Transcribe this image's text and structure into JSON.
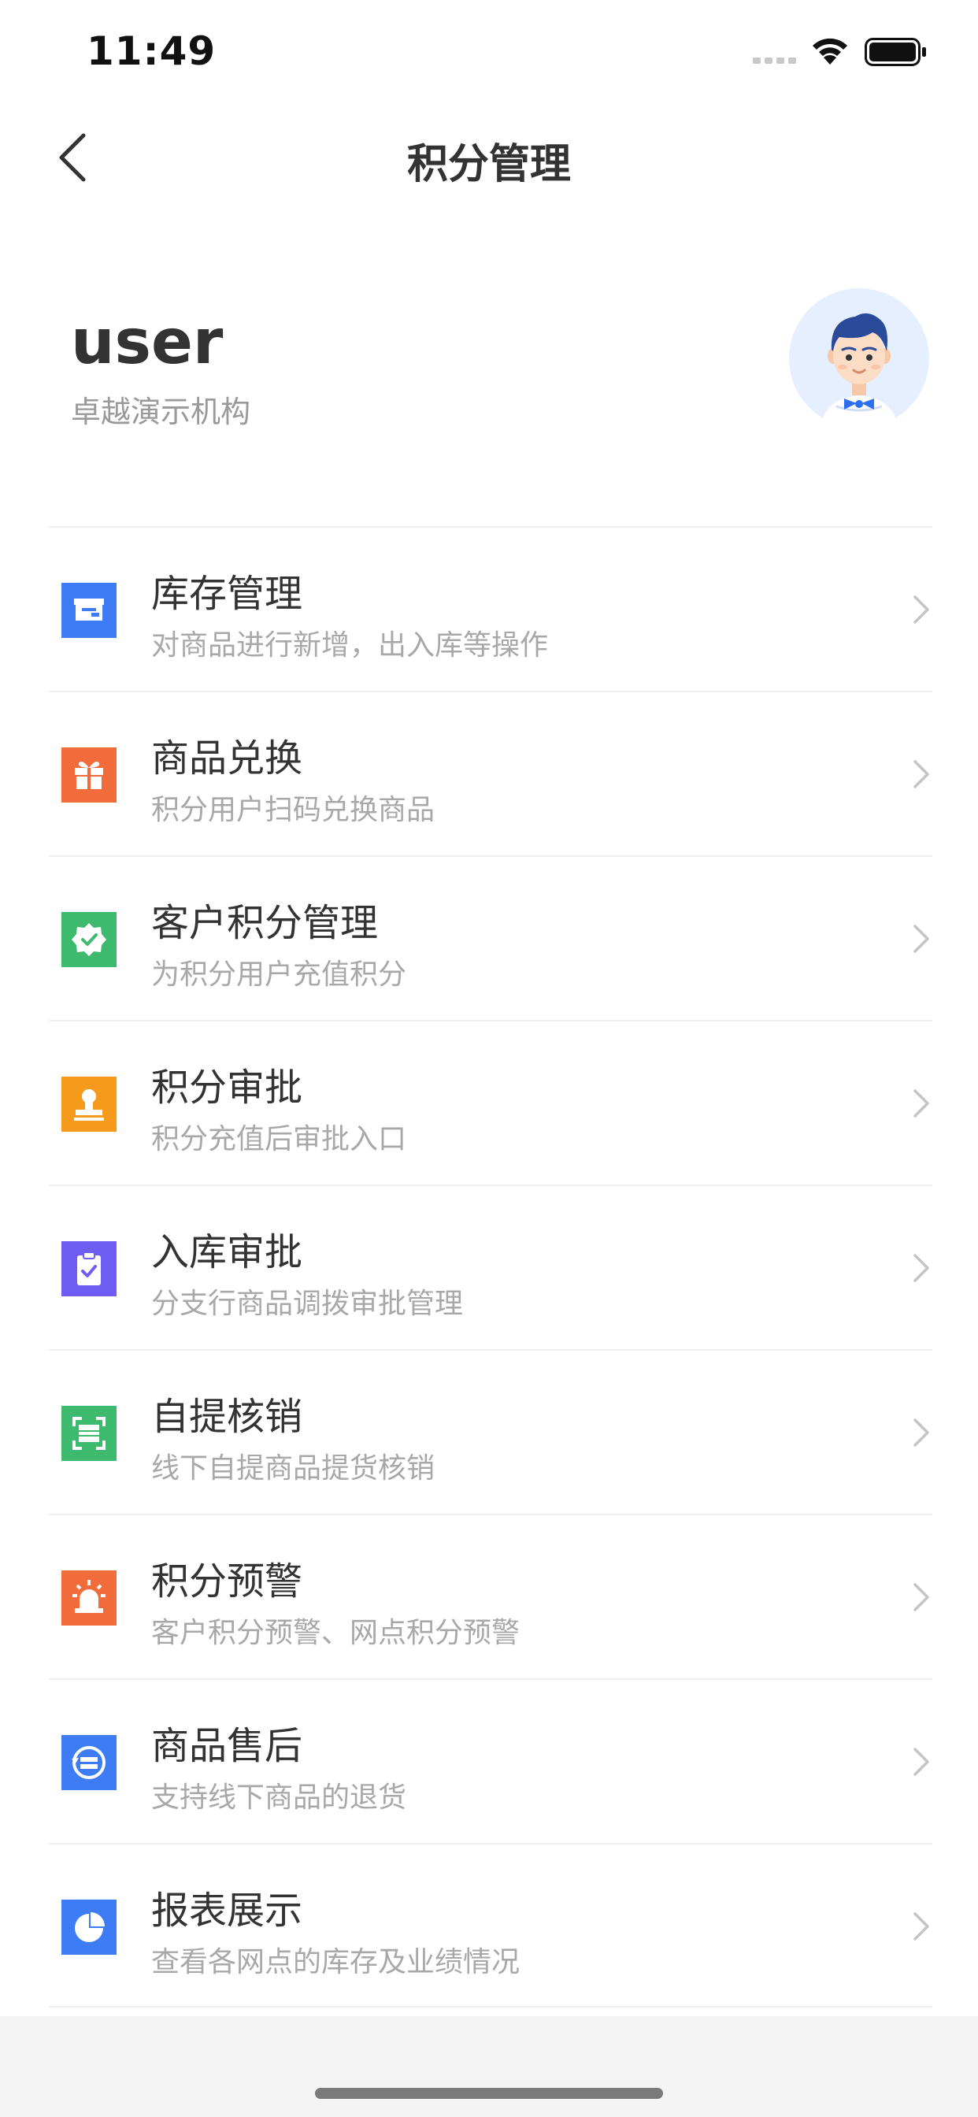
{
  "status_bar": {
    "time": "11:49"
  },
  "nav": {
    "title": "积分管理",
    "back_icon": "chevron-left-icon"
  },
  "profile": {
    "name": "user",
    "organization": "卓越演示机构"
  },
  "menu": [
    {
      "title": "库存管理",
      "desc": "对商品进行新增，出入库等操作",
      "icon": "box-icon",
      "color": "#3D7CF4"
    },
    {
      "title": "商品兑换",
      "desc": "积分用户扫码兑换商品",
      "icon": "gift-icon",
      "color": "#F26B3A"
    },
    {
      "title": "客户积分管理",
      "desc": "为积分用户充值积分",
      "icon": "verified-badge-icon",
      "color": "#3DBA6E"
    },
    {
      "title": "积分审批",
      "desc": "积分充值后审批入口",
      "icon": "stamp-icon",
      "color": "#F59A1A"
    },
    {
      "title": "入库审批",
      "desc": "分支行商品调拨审批管理",
      "icon": "clipboard-check-icon",
      "color": "#6F5CF2"
    },
    {
      "title": "自提核销",
      "desc": "线下自提商品提货核销",
      "icon": "scan-icon",
      "color": "#3DBA6E"
    },
    {
      "title": "积分预警",
      "desc": "客户积分预警、网点积分预警",
      "icon": "alarm-icon",
      "color": "#F26B3A"
    },
    {
      "title": "商品售后",
      "desc": "支持线下商品的退货",
      "icon": "refund-icon",
      "color": "#3D7CF4"
    },
    {
      "title": "报表展示",
      "desc": "查看各网点的库存及业绩情况",
      "icon": "pie-chart-icon",
      "color": "#3D7CF4"
    }
  ]
}
